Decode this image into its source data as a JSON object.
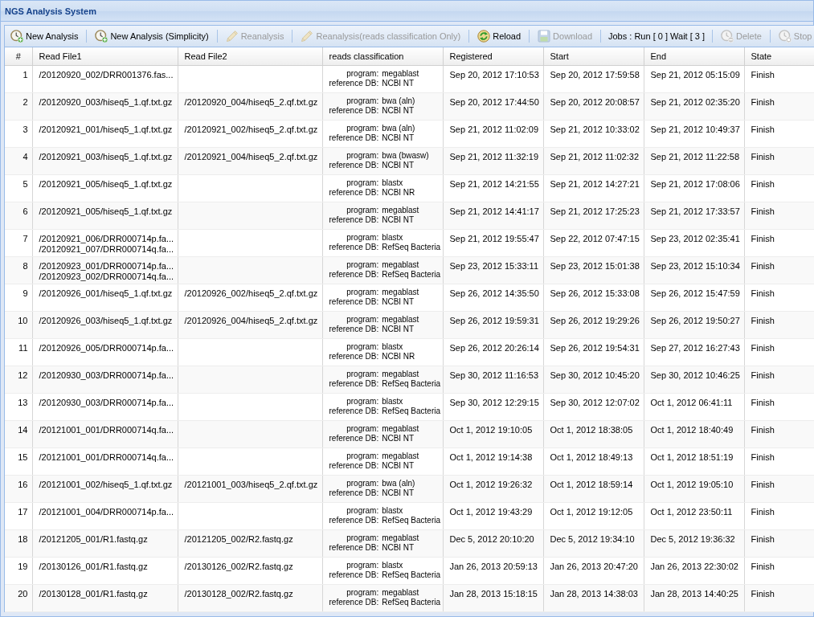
{
  "window": {
    "title": "NGS Analysis System"
  },
  "toolbar": {
    "items": [
      {
        "kind": "add",
        "label": "New Analysis",
        "disabled": false
      },
      {
        "kind": "add",
        "label": "New Analysis (Simplicity)",
        "disabled": false
      },
      {
        "kind": "edit",
        "label": "Reanalysis",
        "disabled": true
      },
      {
        "kind": "edit",
        "label": "Reanalysis(reads classification Only)",
        "disabled": true
      },
      {
        "kind": "reload",
        "label": "Reload",
        "disabled": false
      },
      {
        "kind": "save",
        "label": "Download",
        "disabled": true
      },
      {
        "kind": "status",
        "label": "Jobs : Run [ 0 ] Wait [ 3 ]",
        "disabled": false
      },
      {
        "kind": "remove",
        "label": "Delete",
        "disabled": true
      },
      {
        "kind": "stop",
        "label": "Stop",
        "disabled": true
      }
    ]
  },
  "table": {
    "columns": [
      "#",
      "Read File1",
      "Read File2",
      "reads classification",
      "Registered",
      "Start",
      "End",
      "State"
    ],
    "rows": [
      {
        "number": "1",
        "read_file1": [
          "/20120920_002/DRR001376.fas..."
        ],
        "classification": [
          {
            "label": "program:",
            "value": "megablast"
          },
          {
            "label": "reference DB:",
            "value": "NCBI NT"
          }
        ],
        "registered": "Sep 20, 2012 17:10:53",
        "start": "Sep 20, 2012 17:59:58",
        "end": "Sep 21, 2012 05:15:09",
        "state": "Finish"
      },
      {
        "number": "2",
        "read_file1": [
          "/20120920_003/hiseq5_1.qf.txt.gz"
        ],
        "read_file2": [
          "/20120920_004/hiseq5_2.qf.txt.gz"
        ],
        "classification": [
          {
            "label": "program:",
            "value": "bwa (aln)"
          },
          {
            "label": "reference DB:",
            "value": "NCBI NT"
          }
        ],
        "registered": "Sep 20, 2012 17:44:50",
        "start": "Sep 20, 2012 20:08:57",
        "end": "Sep 21, 2012 02:35:20",
        "state": "Finish"
      },
      {
        "number": "3",
        "read_file1": [
          "/20120921_001/hiseq5_1.qf.txt.gz"
        ],
        "read_file2": [
          "/20120921_002/hiseq5_2.qf.txt.gz"
        ],
        "classification": [
          {
            "label": "program:",
            "value": "bwa (aln)"
          },
          {
            "label": "reference DB:",
            "value": "NCBI NT"
          }
        ],
        "registered": "Sep 21, 2012 11:02:09",
        "start": "Sep 21, 2012 10:33:02",
        "end": "Sep 21, 2012 10:49:37",
        "state": "Finish"
      },
      {
        "number": "4",
        "read_file1": [
          "/20120921_003/hiseq5_1.qf.txt.gz"
        ],
        "read_file2": [
          "/20120921_004/hiseq5_2.qf.txt.gz"
        ],
        "classification": [
          {
            "label": "program:",
            "value": "bwa (bwasw)"
          },
          {
            "label": "reference DB:",
            "value": "NCBI NT"
          }
        ],
        "registered": "Sep 21, 2012 11:32:19",
        "start": "Sep 21, 2012 11:02:32",
        "end": "Sep 21, 2012 11:22:58",
        "state": "Finish"
      },
      {
        "number": "5",
        "read_file1": [
          "/20120921_005/hiseq5_1.qf.txt.gz"
        ],
        "classification": [
          {
            "label": "program:",
            "value": "blastx"
          },
          {
            "label": "reference DB:",
            "value": "NCBI NR"
          }
        ],
        "registered": "Sep 21, 2012 14:21:55",
        "start": "Sep 21, 2012 14:27:21",
        "end": "Sep 21, 2012 17:08:06",
        "state": "Finish"
      },
      {
        "number": "6",
        "read_file1": [
          "/20120921_005/hiseq5_1.qf.txt.gz"
        ],
        "classification": [
          {
            "label": "program:",
            "value": "megablast"
          },
          {
            "label": "reference DB:",
            "value": "NCBI NT"
          }
        ],
        "registered": "Sep 21, 2012 14:41:17",
        "start": "Sep 21, 2012 17:25:23",
        "end": "Sep 21, 2012 17:33:57",
        "state": "Finish"
      },
      {
        "number": "7",
        "read_file1": [
          "/20120921_006/DRR000714p.fa...",
          "/20120921_007/DRR000714q.fa..."
        ],
        "classification": [
          {
            "label": "program:",
            "value": "blastx"
          },
          {
            "label": "reference DB:",
            "value": "RefSeq Bacteria"
          }
        ],
        "registered": "Sep 21, 2012 19:55:47",
        "start": "Sep 22, 2012 07:47:15",
        "end": "Sep 23, 2012 02:35:41",
        "state": "Finish"
      },
      {
        "number": "8",
        "read_file1": [
          "/20120923_001/DRR000714p.fa...",
          "/20120923_002/DRR000714q.fa..."
        ],
        "classification": [
          {
            "label": "program:",
            "value": "megablast"
          },
          {
            "label": "reference DB:",
            "value": "RefSeq Bacteria"
          }
        ],
        "registered": "Sep 23, 2012 15:33:11",
        "start": "Sep 23, 2012 15:01:38",
        "end": "Sep 23, 2012 15:10:34",
        "state": "Finish"
      },
      {
        "number": "9",
        "read_file1": [
          "/20120926_001/hiseq5_1.qf.txt.gz"
        ],
        "read_file2": [
          "/20120926_002/hiseq5_2.qf.txt.gz"
        ],
        "classification": [
          {
            "label": "program:",
            "value": "megablast"
          },
          {
            "label": "reference DB:",
            "value": "NCBI NT"
          }
        ],
        "registered": "Sep 26, 2012 14:35:50",
        "start": "Sep 26, 2012 15:33:08",
        "end": "Sep 26, 2012 15:47:59",
        "state": "Finish"
      },
      {
        "number": "10",
        "read_file1": [
          "/20120926_003/hiseq5_1.qf.txt.gz"
        ],
        "read_file2": [
          "/20120926_004/hiseq5_2.qf.txt.gz"
        ],
        "classification": [
          {
            "label": "program:",
            "value": "megablast"
          },
          {
            "label": "reference DB:",
            "value": "NCBI NT"
          }
        ],
        "registered": "Sep 26, 2012 19:59:31",
        "start": "Sep 26, 2012 19:29:26",
        "end": "Sep 26, 2012 19:50:27",
        "state": "Finish"
      },
      {
        "number": "11",
        "read_file1": [
          "/20120926_005/DRR000714p.fa..."
        ],
        "classification": [
          {
            "label": "program:",
            "value": "blastx"
          },
          {
            "label": "reference DB:",
            "value": "NCBI NR"
          }
        ],
        "registered": "Sep 26, 2012 20:26:14",
        "start": "Sep 26, 2012 19:54:31",
        "end": "Sep 27, 2012 16:27:43",
        "state": "Finish"
      },
      {
        "number": "12",
        "read_file1": [
          "/20120930_003/DRR000714p.fa..."
        ],
        "classification": [
          {
            "label": "program:",
            "value": "megablast"
          },
          {
            "label": "reference DB:",
            "value": "RefSeq Bacteria"
          }
        ],
        "registered": "Sep 30, 2012 11:16:53",
        "start": "Sep 30, 2012 10:45:20",
        "end": "Sep 30, 2012 10:46:25",
        "state": "Finish"
      },
      {
        "number": "13",
        "read_file1": [
          "/20120930_003/DRR000714p.fa..."
        ],
        "classification": [
          {
            "label": "program:",
            "value": "blastx"
          },
          {
            "label": "reference DB:",
            "value": "RefSeq Bacteria"
          }
        ],
        "registered": "Sep 30, 2012 12:29:15",
        "start": "Sep 30, 2012 12:07:02",
        "end": "Oct 1, 2012 06:41:11",
        "state": "Finish"
      },
      {
        "number": "14",
        "read_file1": [
          "/20121001_001/DRR000714q.fa..."
        ],
        "classification": [
          {
            "label": "program:",
            "value": "megablast"
          },
          {
            "label": "reference DB:",
            "value": "NCBI NT"
          }
        ],
        "registered": "Oct 1, 2012 19:10:05",
        "start": "Oct 1, 2012 18:38:05",
        "end": "Oct 1, 2012 18:40:49",
        "state": "Finish"
      },
      {
        "number": "15",
        "read_file1": [
          "/20121001_001/DRR000714q.fa..."
        ],
        "classification": [
          {
            "label": "program:",
            "value": "megablast"
          },
          {
            "label": "reference DB:",
            "value": "NCBI NT"
          }
        ],
        "registered": "Oct 1, 2012 19:14:38",
        "start": "Oct 1, 2012 18:49:13",
        "end": "Oct 1, 2012 18:51:19",
        "state": "Finish"
      },
      {
        "number": "16",
        "read_file1": [
          "/20121001_002/hiseq5_1.qf.txt.gz"
        ],
        "read_file2": [
          "/20121001_003/hiseq5_2.qf.txt.gz"
        ],
        "classification": [
          {
            "label": "program:",
            "value": "bwa (aln)"
          },
          {
            "label": "reference DB:",
            "value": "NCBI NT"
          }
        ],
        "registered": "Oct 1, 2012 19:26:32",
        "start": "Oct 1, 2012 18:59:14",
        "end": "Oct 1, 2012 19:05:10",
        "state": "Finish"
      },
      {
        "number": "17",
        "read_file1": [
          "/20121001_004/DRR000714p.fa..."
        ],
        "classification": [
          {
            "label": "program:",
            "value": "blastx"
          },
          {
            "label": "reference DB:",
            "value": "RefSeq Bacteria"
          }
        ],
        "registered": "Oct 1, 2012 19:43:29",
        "start": "Oct 1, 2012 19:12:05",
        "end": "Oct 1, 2012 23:50:11",
        "state": "Finish"
      },
      {
        "number": "18",
        "read_file1": [
          "/20121205_001/R1.fastq.gz"
        ],
        "read_file2": [
          "/20121205_002/R2.fastq.gz"
        ],
        "classification": [
          {
            "label": "program:",
            "value": "megablast"
          },
          {
            "label": "reference DB:",
            "value": "NCBI NT"
          }
        ],
        "registered": "Dec 5, 2012 20:10:20",
        "start": "Dec 5, 2012 19:34:10",
        "end": "Dec 5, 2012 19:36:32",
        "state": "Finish"
      },
      {
        "number": "19",
        "read_file1": [
          "/20130126_001/R1.fastq.gz"
        ],
        "read_file2": [
          "/20130126_002/R2.fastq.gz"
        ],
        "classification": [
          {
            "label": "program:",
            "value": "blastx"
          },
          {
            "label": "reference DB:",
            "value": "RefSeq Bacteria"
          }
        ],
        "registered": "Jan 26, 2013 20:59:13",
        "start": "Jan 26, 2013 20:47:20",
        "end": "Jan 26, 2013 22:30:02",
        "state": "Finish"
      },
      {
        "number": "20",
        "read_file1": [
          "/20130128_001/R1.fastq.gz"
        ],
        "read_file2": [
          "/20130128_002/R2.fastq.gz"
        ],
        "classification": [
          {
            "label": "program:",
            "value": "megablast"
          },
          {
            "label": "reference DB:",
            "value": "RefSeq Bacteria"
          }
        ],
        "registered": "Jan 28, 2013 15:18:15",
        "start": "Jan 28, 2013 14:38:03",
        "end": "Jan 28, 2013 14:40:25",
        "state": "Finish"
      }
    ]
  }
}
